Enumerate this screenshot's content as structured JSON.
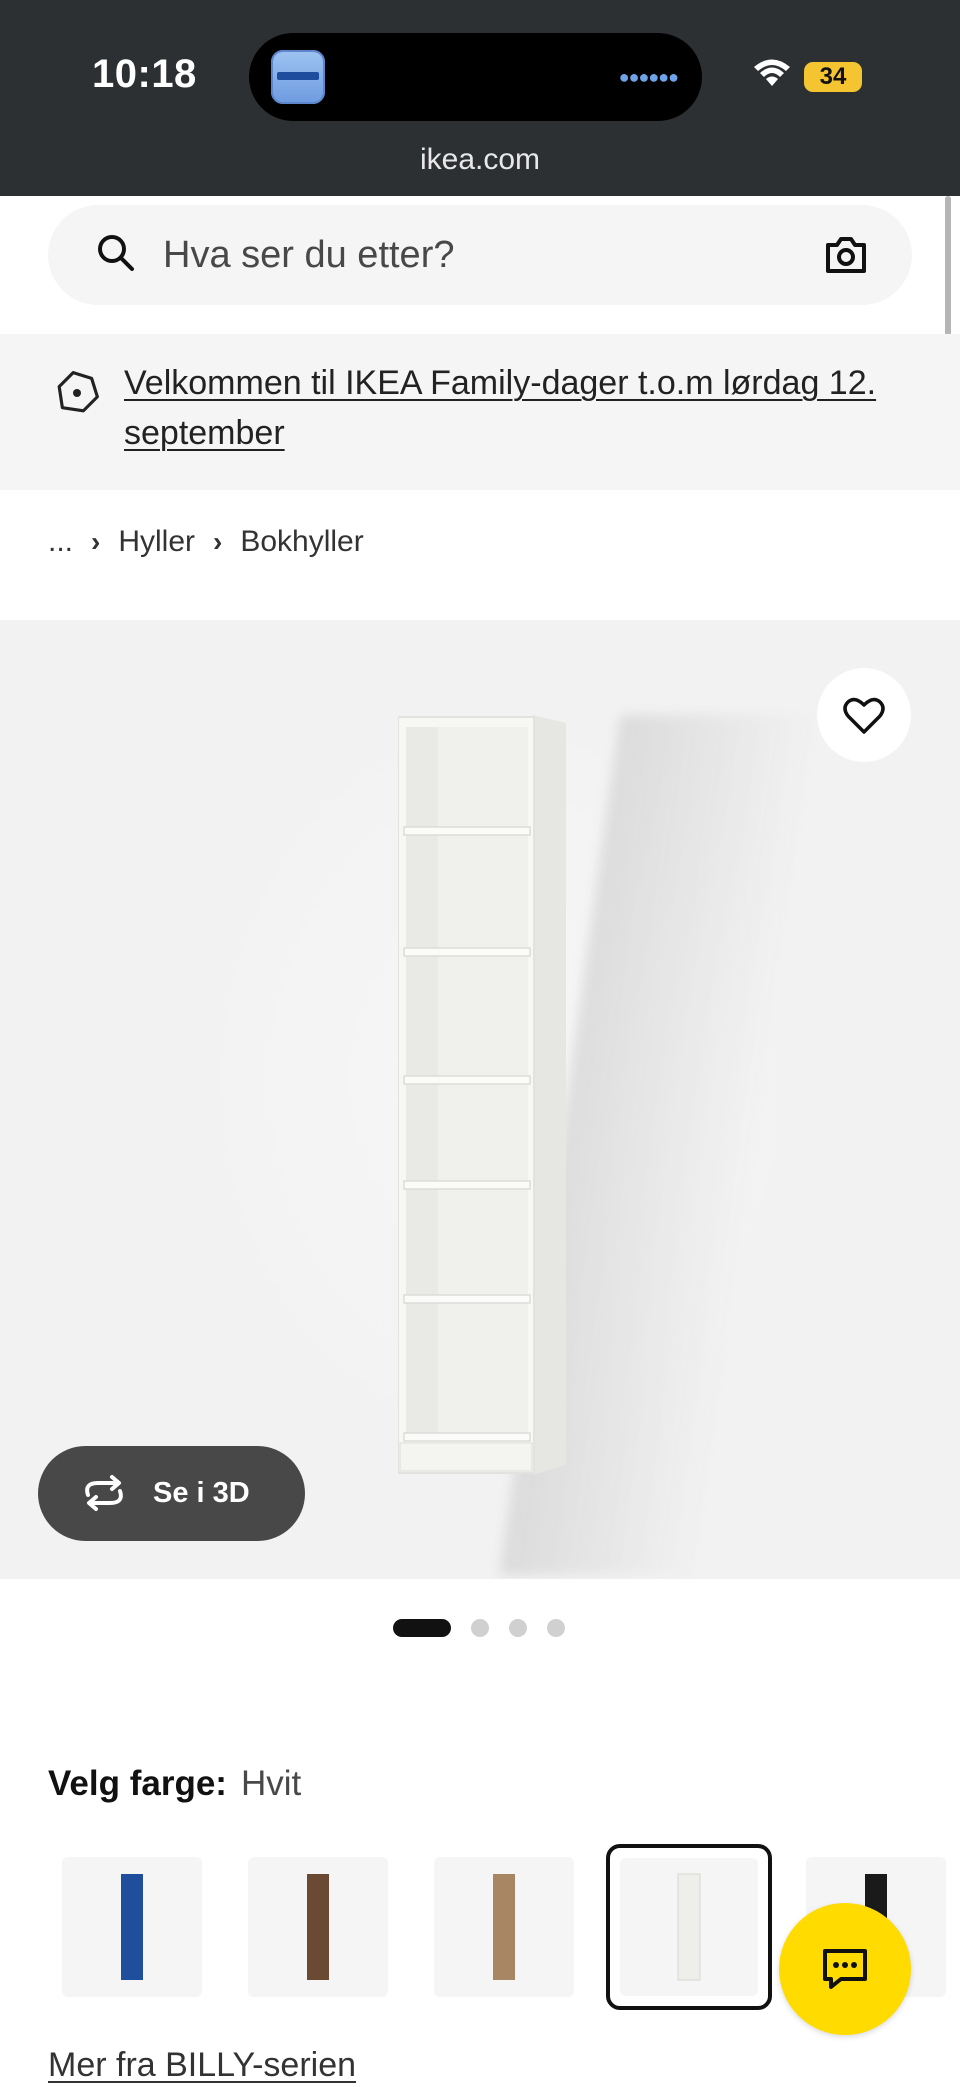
{
  "status_bar": {
    "time": "10:18",
    "battery": "34",
    "url": "ikea.com"
  },
  "search": {
    "placeholder": "Hva ser du etter?"
  },
  "banner": {
    "text": "Velkommen til IKEA Family-dager t.o.m lørdag 12. september"
  },
  "breadcrumb": {
    "items": [
      "...",
      "Hyller",
      "Bokhyller"
    ]
  },
  "gallery": {
    "view_3d_label": "Se i 3D",
    "image_count": 4,
    "active_index": 0
  },
  "color_picker": {
    "label": "Velg farge:",
    "selected": "Hvit",
    "options": [
      {
        "color": "#1f4f9c"
      },
      {
        "color": "#6b4a33"
      },
      {
        "color": "#a88563"
      },
      {
        "color": "#eeeeea"
      },
      {
        "color": "#1a1a1a"
      }
    ],
    "selected_index": 3
  },
  "series_link": "Mer fra BILLY-serien",
  "colors": {
    "accent_yellow": "#ffdb00",
    "status_bar_bg": "#2d3033"
  }
}
